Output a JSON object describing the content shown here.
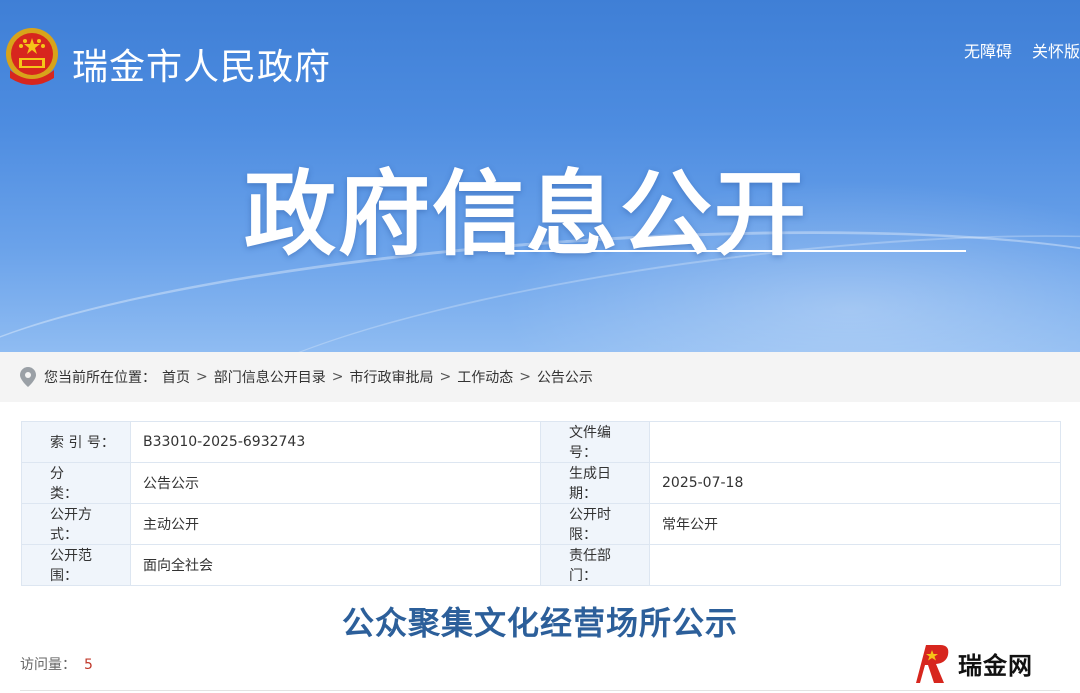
{
  "header": {
    "site_title": "瑞金市人民政府",
    "links": [
      "无障碍",
      "关怀版"
    ]
  },
  "hero": {
    "title": "政府信息公开"
  },
  "breadcrumb": {
    "lead": "您当前所在位置：",
    "items": [
      "首页",
      "部门信息公开目录",
      "市行政审批局",
      "工作动态",
      "公告公示"
    ],
    "separator": ">"
  },
  "meta": {
    "rows": [
      {
        "label_left": "索 引 号：",
        "value_left": "B33010-2025-6932743",
        "label_right": "文件编号：",
        "value_right": ""
      },
      {
        "label_left": "分　　类：",
        "value_left": "公告公示",
        "label_right": "生成日期：",
        "value_right": "2025-07-18"
      },
      {
        "label_left": "公开方式：",
        "value_left": "主动公开",
        "label_right": "公开时限：",
        "value_right": "常年公开"
      },
      {
        "label_left": "公开范围：",
        "value_left": "面向全社会",
        "label_right": "责任部门：",
        "value_right": ""
      }
    ]
  },
  "article": {
    "title": "公众聚集文化经营场所公示",
    "visits_label": "访问量：",
    "visits_count": "5"
  },
  "watermark": {
    "text": "瑞金网"
  },
  "colors": {
    "banner": "#4d8ce0",
    "title_blue": "#2c5f9a",
    "label_bg": "#f0f5fb"
  }
}
